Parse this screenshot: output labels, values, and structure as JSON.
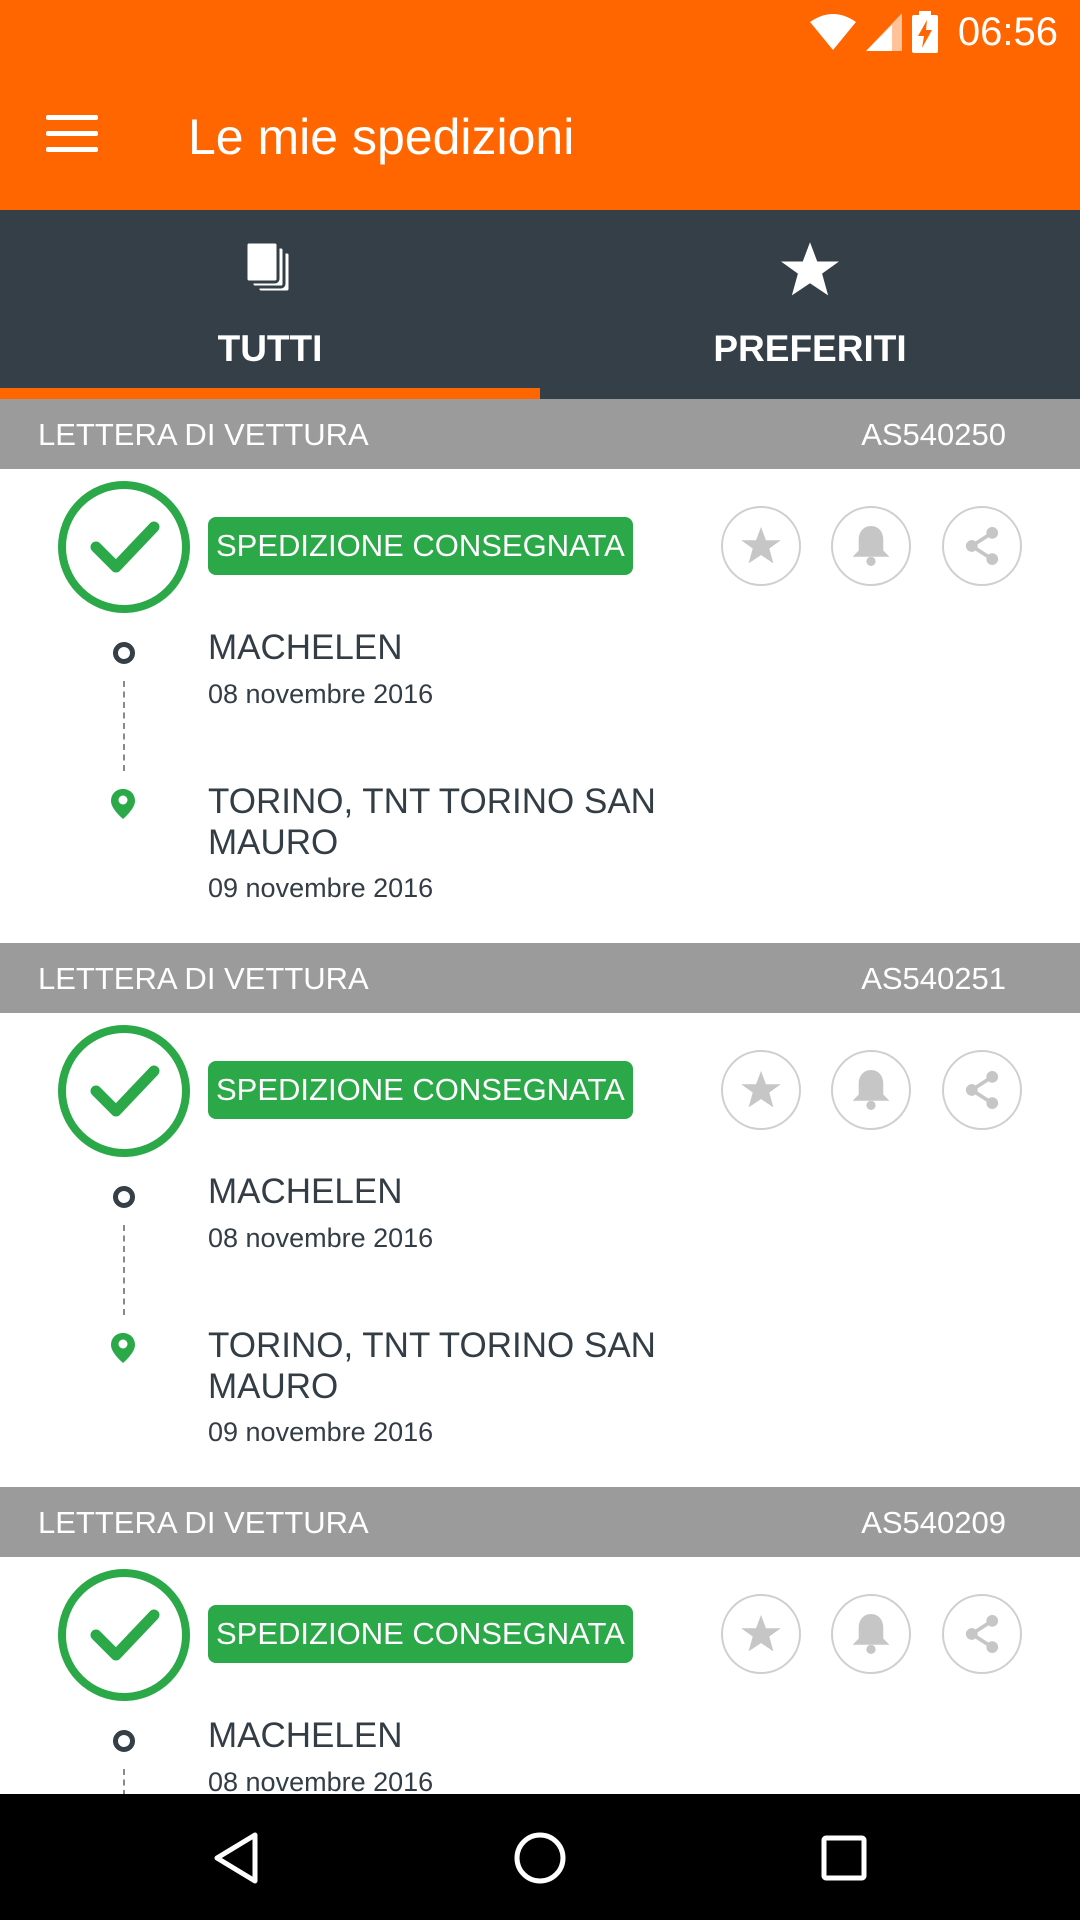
{
  "status_bar": {
    "time": "06:56",
    "icons": [
      "wifi-icon",
      "signal-icon",
      "battery-charging-icon"
    ]
  },
  "app_bar": {
    "title": "Le mie spedizioni",
    "menu_icon": "hamburger-menu-icon"
  },
  "tabs": [
    {
      "label": "TUTTI",
      "icon": "documents-icon",
      "selected": true
    },
    {
      "label": "PREFERITI",
      "icon": "star-icon",
      "selected": false
    }
  ],
  "colors": {
    "brand": "#ff6600",
    "tabbar": "#353f48",
    "success": "#2ba847",
    "section": "#9b9b9b"
  },
  "shipments": [
    {
      "header_label": "LETTERA DI VETTURA",
      "code": "AS540250",
      "status": "SPEDIZIONE CONSEGNATA",
      "origin": {
        "name": "MACHELEN",
        "date": "08 novembre 2016"
      },
      "destination": {
        "name": "TORINO, TNT TORINO SAN MAURO",
        "date": "09 novembre 2016"
      }
    },
    {
      "header_label": "LETTERA DI VETTURA",
      "code": "AS540251",
      "status": "SPEDIZIONE CONSEGNATA",
      "origin": {
        "name": "MACHELEN",
        "date": "08 novembre 2016"
      },
      "destination": {
        "name": "TORINO, TNT TORINO SAN MAURO",
        "date": "09 novembre 2016"
      }
    },
    {
      "header_label": "LETTERA DI VETTURA",
      "code": "AS540209",
      "status": "SPEDIZIONE CONSEGNATA",
      "origin": {
        "name": "MACHELEN",
        "date": "08 novembre 2016"
      }
    }
  ],
  "nav_bar": {
    "icons": [
      "back-icon",
      "home-icon",
      "recents-icon"
    ]
  }
}
